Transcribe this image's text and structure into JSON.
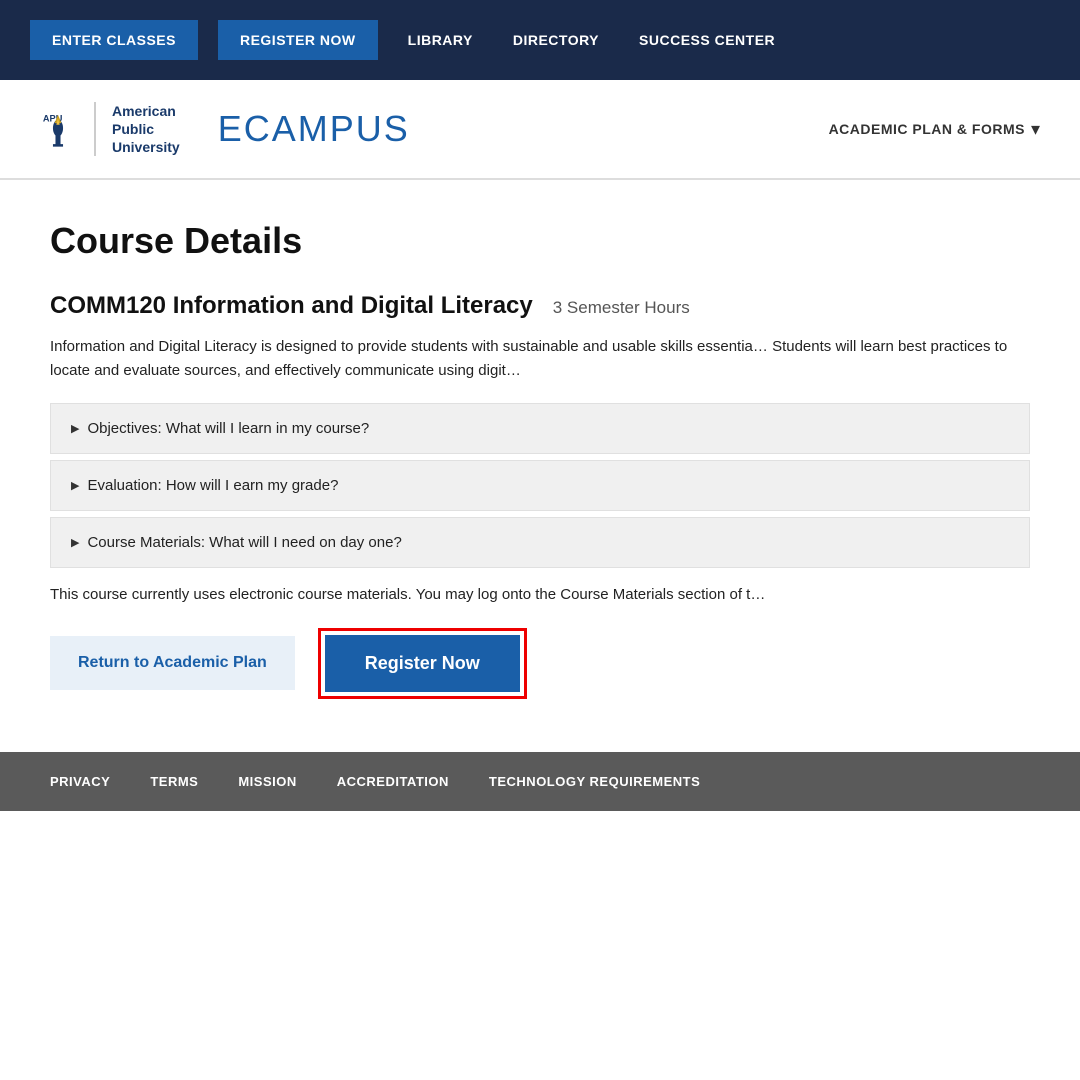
{
  "topNav": {
    "btn1": "ENTER CLASSES",
    "btn2": "REGISTER NOW",
    "link1": "LIBRARY",
    "link2": "DIRECTORY",
    "link3": "SUCCESS CENTER"
  },
  "header": {
    "universityLine1": "American",
    "universityLine2": "Public",
    "universityLine3": "University",
    "apuLabel": "APU",
    "ecampus": "ECAMPUS",
    "academicPlanLink": "ACADEMIC PLAN & FORMS"
  },
  "main": {
    "pageTitle": "Course Details",
    "courseTitle": "COMM120 Information and Digital Literacy",
    "semesterHours": "3 Semester Hours",
    "courseDescription": "Information and Digital Literacy is designed to provide students with sustainable and usable skills essentia… Students will learn best practices to locate and evaluate sources, and effectively communicate using digit…",
    "accordionItems": [
      "Objectives: What will I learn in my course?",
      "Evaluation: How will I earn my grade?",
      "Course Materials: What will I need on day one?"
    ],
    "materialsNote": "This course currently uses electronic course materials. You may log onto the Course Materials section of t…",
    "btnReturn": "Return to Academic Plan",
    "btnRegister": "Register Now"
  },
  "footer": {
    "links": [
      "PRIVACY",
      "TERMS",
      "MISSION",
      "ACCREDITATION",
      "TECHNOLOGY REQUIREMENTS"
    ]
  }
}
